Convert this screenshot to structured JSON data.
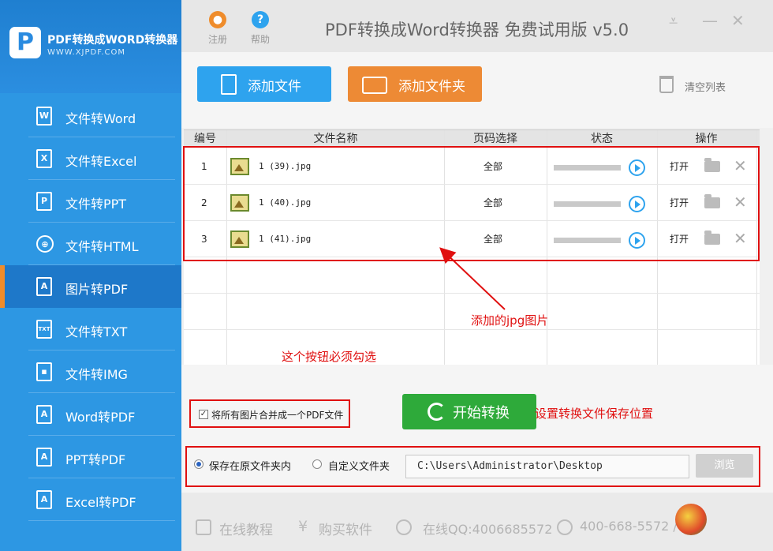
{
  "app": {
    "logo_title": "PDF转换成WORD转换器",
    "logo_url": "WWW.XJPDF.COM",
    "title": "PDF转换成Word转换器 免费试用版 v5.0",
    "register_label": "注册",
    "help_label": "帮助"
  },
  "sidebar": {
    "items": [
      {
        "label": "文件转Word",
        "icon": "W"
      },
      {
        "label": "文件转Excel",
        "icon": "X"
      },
      {
        "label": "文件转PPT",
        "icon": "P"
      },
      {
        "label": "文件转HTML",
        "icon": "globe"
      },
      {
        "label": "图片转PDF",
        "icon": "pdf",
        "active": true
      },
      {
        "label": "文件转TXT",
        "icon": "TXT"
      },
      {
        "label": "文件转IMG",
        "icon": "image"
      },
      {
        "label": "Word转PDF",
        "icon": "pdf"
      },
      {
        "label": "PPT转PDF",
        "icon": "pdf"
      },
      {
        "label": "Excel转PDF",
        "icon": "pdf"
      }
    ]
  },
  "toolbar": {
    "add_file": "添加文件",
    "add_folder": "添加文件夹",
    "clear_list": "清空列表"
  },
  "table": {
    "headers": [
      "编号",
      "文件名称",
      "页码选择",
      "状态",
      "操作"
    ],
    "rows": [
      {
        "num": "1",
        "name": "1 (39).jpg",
        "pages": "全部",
        "open": "打开"
      },
      {
        "num": "2",
        "name": "1 (40).jpg",
        "pages": "全部",
        "open": "打开"
      },
      {
        "num": "3",
        "name": "1 (41).jpg",
        "pages": "全部",
        "open": "打开"
      }
    ]
  },
  "annotations": {
    "added_jpg": "添加的jpg图片",
    "must_check": "这个按钮必须勾选",
    "set_location": "设置转换文件保存位置"
  },
  "options": {
    "merge_label": "将所有图片合并成一个PDF文件",
    "merge_checked": true,
    "start_label": "开始转换",
    "save_original": "保存在原文件夹内",
    "save_custom": "自定义文件夹",
    "path_value": "C:\\Users\\Administrator\\Desktop",
    "browse_label": "浏览"
  },
  "footer": {
    "tutorial": "在线教程",
    "buy": "购买软件",
    "qq": "在线QQ:4006685572",
    "phone": "400-668-5572 /"
  },
  "colors": {
    "sidebar_bg": "#2d97e3",
    "active_marker": "#ef8c2b",
    "add_file_btn": "#2ea3ee",
    "add_folder_btn": "#ed8a35",
    "start_btn": "#2eaa3a",
    "annotation_red": "#e01010"
  }
}
